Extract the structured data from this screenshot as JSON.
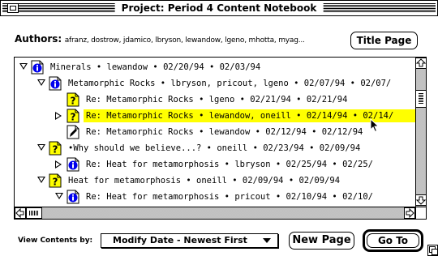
{
  "window": {
    "title": "Project: Period 4 Content Notebook"
  },
  "authors": {
    "label": "Authors:",
    "value": "afranz, dostrow, jdamico, lbryson, lewandow, lgeno, mhotta, myag..."
  },
  "buttons": {
    "title_page": "Title Page",
    "new_page": "New Page",
    "go_to": "Go To"
  },
  "entries": [
    {
      "text": "Minerals • lewandow • 02/20/94 • 02/03/94",
      "expander": "down",
      "icon": "info-page-icon",
      "selected": false
    },
    {
      "text": "Metamorphic Rocks • lbryson, pricout, lgeno • 02/07/94 • 02/07/",
      "expander": "down",
      "icon": "info-page-icon",
      "selected": false
    },
    {
      "text": "Re: Metamorphic Rocks • lgeno • 02/21/94 • 02/21/94",
      "expander": "none",
      "icon": "question-page-icon",
      "selected": false
    },
    {
      "text": "Re: Metamorphic Rocks • lewandow, oneill • 02/14/94 • 02/14/",
      "expander": "right",
      "icon": "question-page-icon",
      "selected": true
    },
    {
      "text": "Re: Metamorphic Rocks • lewandow • 02/12/94 • 02/12/94",
      "expander": "none",
      "icon": "pen-page-icon",
      "selected": false
    },
    {
      "text": "•Why should we believe...? • oneill • 02/23/94 • 02/09/94",
      "expander": "down",
      "icon": "question-page-icon",
      "selected": false
    },
    {
      "text": "Re: Heat for metamorphosis • lbryson • 02/25/94 • 02/25/",
      "expander": "right",
      "icon": "info-page-icon",
      "selected": false
    },
    {
      "text": "Heat for metamorphosis • oneill • 02/09/94 • 02/09/94",
      "expander": "down",
      "icon": "question-page-icon",
      "selected": false
    },
    {
      "text": "Re: Heat for metamorphosis • pricout • 02/10/94 • 02/10/",
      "expander": "down",
      "icon": "info-page-icon",
      "selected": false
    }
  ],
  "view_contents": {
    "label": "View Contents by:",
    "selected": "Modify Date - Newest First"
  },
  "colors": {
    "selection": "#ffff00",
    "icon_blue": "#0000ee",
    "icon_yellow": "#ffff00"
  }
}
